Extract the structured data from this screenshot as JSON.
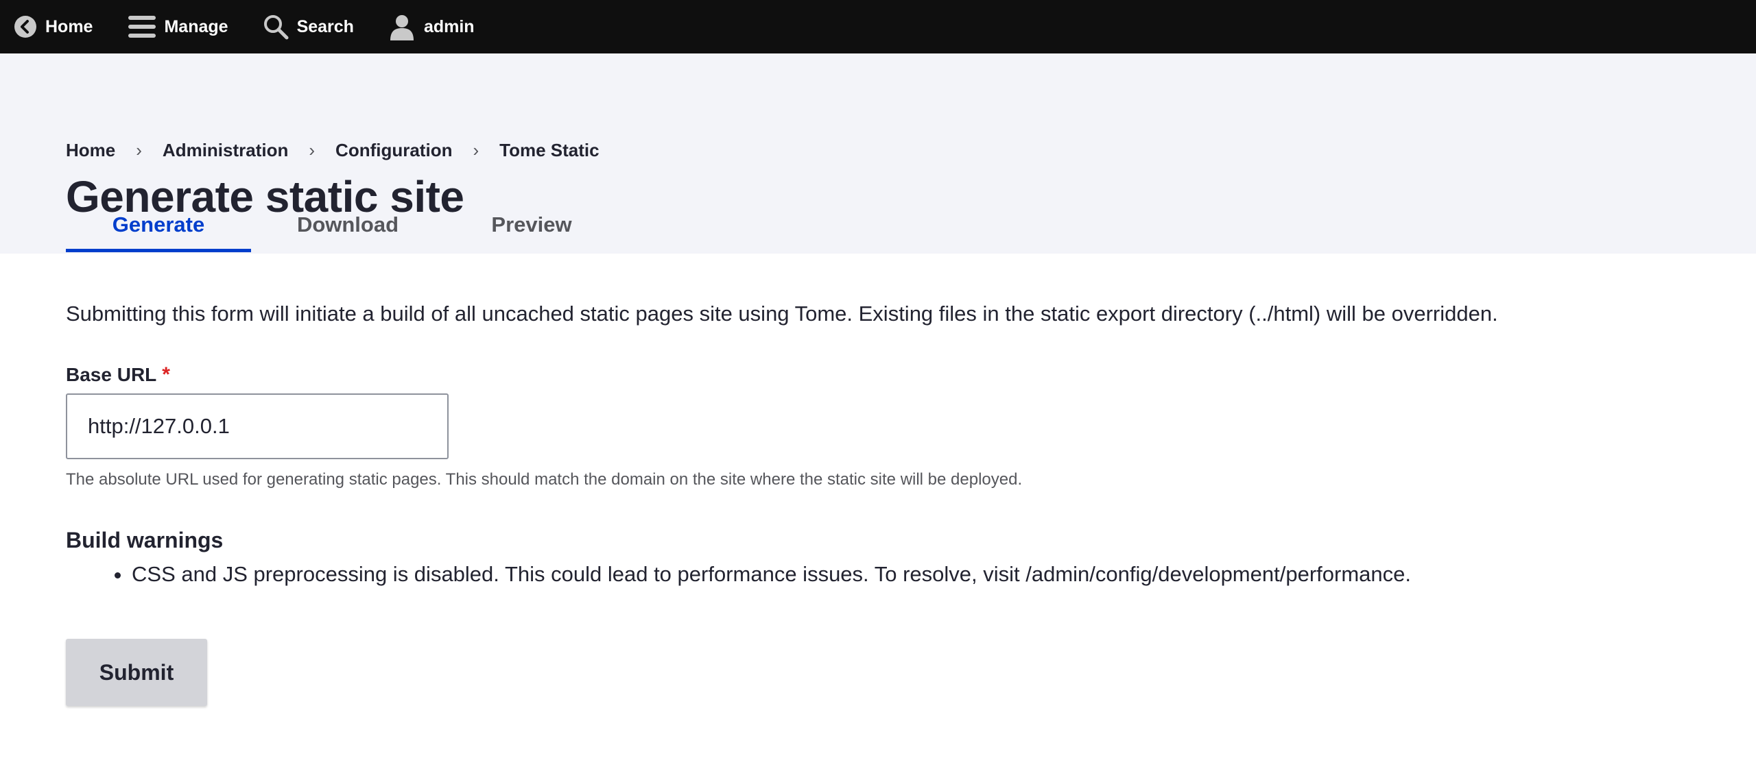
{
  "toolbar": {
    "items": [
      {
        "label": "Home",
        "icon": "chevron-left-circle-icon"
      },
      {
        "label": "Manage",
        "icon": "hamburger-icon"
      },
      {
        "label": "Search",
        "icon": "search-icon"
      },
      {
        "label": "admin",
        "icon": "user-icon"
      }
    ]
  },
  "breadcrumb": {
    "items": [
      "Home",
      "Administration",
      "Configuration",
      "Tome Static"
    ],
    "separator": "›"
  },
  "page": {
    "title": "Generate static site"
  },
  "tabs": [
    {
      "label": "Generate",
      "active": true
    },
    {
      "label": "Download",
      "active": false
    },
    {
      "label": "Preview",
      "active": false
    }
  ],
  "form": {
    "description": "Submitting this form will initiate a build of all uncached static pages site using Tome. Existing files in the static export directory (../html) will be overridden.",
    "base_url": {
      "label": "Base URL",
      "required_mark": "*",
      "value": "http://127.0.0.1",
      "help": "The absolute URL used for generating static pages. This should match the domain on the site where the static site will be deployed."
    },
    "warnings": {
      "title": "Build warnings",
      "items": [
        "CSS and JS preprocessing is disabled. This could lead to performance issues. To resolve, visit /admin/config/development/performance."
      ]
    },
    "submit_label": "Submit"
  },
  "colors": {
    "toolbar_bg": "#0f0f0f",
    "header_bg": "#f3f4f9",
    "accent": "#003ecc",
    "required": "#dc2323",
    "button_bg": "#d3d4d9"
  }
}
